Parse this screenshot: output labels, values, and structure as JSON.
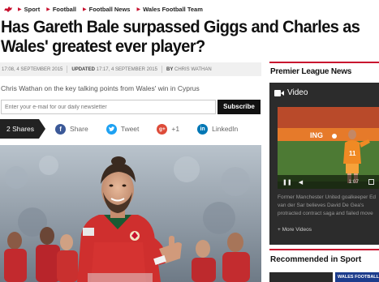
{
  "breadcrumb": {
    "items": [
      "Sport",
      "Football",
      "Football News",
      "Wales Football Team"
    ]
  },
  "article": {
    "headline": "Has Gareth Bale surpassed Giggs and Charles as Wales' greatest ever player?",
    "published": "17:08, 4 SEPTEMBER 2015",
    "updated_label": "UPDATED",
    "updated": "17:17, 4 SEPTEMBER 2015",
    "by_label": "BY",
    "author": "CHRIS WATHAN",
    "standfirst": "Chris Wathan on the key talking points from Wales' win in Cyprus"
  },
  "newsletter": {
    "placeholder": "Enter your e-mail for our daily newsletter",
    "button": "Subscribe"
  },
  "share": {
    "count": "2 Shares",
    "facebook": "Share",
    "twitter": "Tweet",
    "google": "+1",
    "linkedin": "LinkedIn"
  },
  "sidebar": {
    "heading": "Premier League News",
    "video_heading": "Video",
    "video_time": "1:07",
    "video_caption_1": "Former Manchester United goalkeeper Ed",
    "video_caption_2": "van der Sar believes David De Gea's",
    "video_caption_3": "protracted contract saga and failed move",
    "more_videos": "+ More Videos",
    "video_banner": "ING",
    "recommended_heading": "Recommended in Sport",
    "rec_thumb_text": "WALES FOOTBALL TEAM"
  },
  "colors": {
    "accent": "#c8102e",
    "facebook": "#3b5998",
    "twitter": "#1da1f2",
    "google": "#dd4b39",
    "linkedin": "#0077b5"
  }
}
